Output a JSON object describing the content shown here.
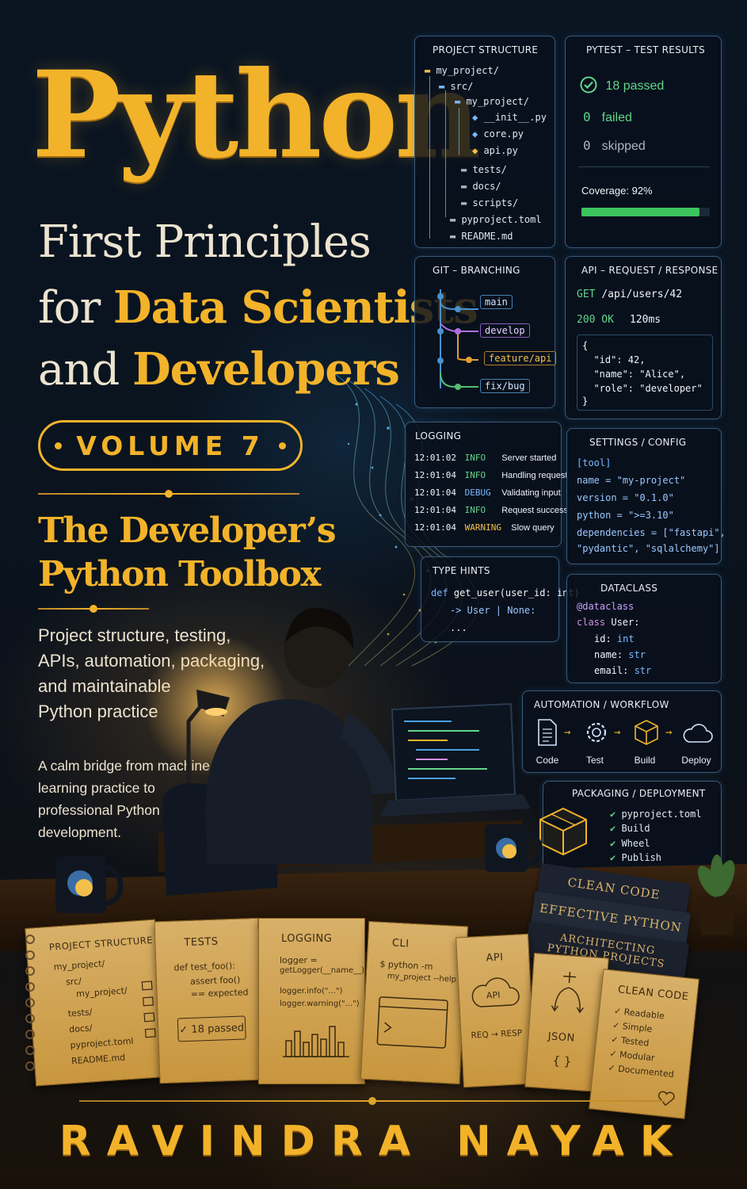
{
  "title": {
    "main": "Python",
    "line1": "First Principles",
    "line2_prefix": "for ",
    "line2_accent": "Data Scientists",
    "line3_prefix": "and ",
    "line3_accent": "Developers"
  },
  "volume": {
    "label": "VOLUME 7"
  },
  "subtitle": {
    "line1": "The Developer’s",
    "line2": "Python Toolbox"
  },
  "description": {
    "lines": [
      "Project structure, testing,",
      "APIs, automation, packaging,",
      "and maintainable",
      "Python practice"
    ],
    "tagline": [
      "A calm bridge from machine",
      "learning practice to",
      "professional Python",
      "development."
    ]
  },
  "author": "RAVINDRA NAYAK",
  "panels": {
    "project_structure": {
      "heading": "PROJECT STRUCTURE",
      "items": [
        "my_project/",
        "src/",
        "my_project/",
        "__init__.py",
        "core.py",
        "api.py",
        "tests/",
        "docs/",
        "scripts/",
        "pyproject.toml",
        "README.md"
      ]
    },
    "pytest": {
      "heading": "PYTEST – TEST RESULTS",
      "passed": "18 passed",
      "failed_num": "0",
      "failed": "failed",
      "skipped_num": "0",
      "skipped": "skipped",
      "coverage_label": "Coverage: 92%",
      "coverage_value": 0.92
    },
    "git": {
      "heading": "GIT – BRANCHING",
      "branches": [
        "main",
        "develop",
        "feature/api",
        "fix/bug"
      ]
    },
    "api": {
      "heading": "API – REQUEST / RESPONSE",
      "method": "GET",
      "path": "/api/users/42",
      "status": "200 OK",
      "time": "120ms",
      "json": [
        "{",
        "  \"id\": 42,",
        "  \"name\": \"Alice\",",
        "  \"role\": \"developer\"",
        "}"
      ]
    },
    "logging": {
      "heading": "LOGGING",
      "rows": [
        {
          "time": "12:01:02",
          "level": "INFO",
          "msg": "Server started"
        },
        {
          "time": "12:01:04",
          "level": "INFO",
          "msg": "Handling request"
        },
        {
          "time": "12:01:04",
          "level": "DEBUG",
          "msg": "Validating input"
        },
        {
          "time": "12:01:04",
          "level": "INFO",
          "msg": "Request success"
        },
        {
          "time": "12:01:04",
          "level": "WARNING",
          "msg": "Slow query"
        }
      ]
    },
    "settings": {
      "heading": "SETTINGS / CONFIG",
      "lines": [
        "[tool]",
        "name = \"my-project\"",
        "version = \"0.1.0\"",
        "python = \">=3.10\"",
        "dependencies = [\"fastapi\",",
        "\"pydantic\", \"sqlalchemy\"]"
      ]
    },
    "type_hints": {
      "heading": "TYPE HINTS",
      "line1_kw": "def",
      "line1_rest": " get_user(user_id: int)",
      "line2": "-> User | None:",
      "line3": "..."
    },
    "dataclass": {
      "heading": "DATACLASS",
      "decorator": "@dataclass",
      "class_kw": "class",
      "class_name": " User:",
      "fields": [
        {
          "name": "id: ",
          "type": "int"
        },
        {
          "name": "name: ",
          "type": "str"
        },
        {
          "name": "email: ",
          "type": "str"
        }
      ]
    },
    "automation": {
      "heading": "AUTOMATION / WORKFLOW",
      "steps": [
        {
          "label": "Code",
          "icon": "document-icon"
        },
        {
          "label": "Test",
          "icon": "gear-icon"
        },
        {
          "label": "Build",
          "icon": "cube-icon"
        },
        {
          "label": "Deploy",
          "icon": "cloud-icon"
        }
      ]
    },
    "packaging": {
      "heading": "PACKAGING / DEPLOYMENT",
      "items": [
        "pyproject.toml",
        "Build",
        "Wheel",
        "Publish"
      ]
    }
  },
  "books": [
    "CLEAN CODE",
    "EFFECTIVE PYTHON",
    "ARCHITECTING",
    "PYTHON PROJECTS"
  ],
  "notebook": {
    "project": {
      "title": "PROJECT STRUCTURE",
      "lines": [
        "my_project/",
        "src/",
        "my_project/",
        "tests/",
        "docs/",
        "pyproject.toml",
        "README.md"
      ]
    },
    "tests": {
      "title": "TESTS",
      "lines": [
        "def test_foo():",
        "assert foo()",
        "== expected"
      ],
      "badge": "✓ 18 passed"
    },
    "logging": {
      "title": "LOGGING",
      "lines": [
        "logger =",
        "getLogger(__name__)",
        "logger.info(\"...\")",
        "logger.warning(\"...\")"
      ]
    },
    "cli": {
      "title": "CLI",
      "lines": [
        "$ python -m",
        "my_project --help"
      ]
    },
    "api": {
      "title": "API",
      "badge": "API",
      "line": "REQ → RESP"
    },
    "json": {
      "title": "JSON",
      "braces": "{ }"
    },
    "clean": {
      "title": "CLEAN CODE",
      "items": [
        "Readable",
        "Simple",
        "Tested",
        "Modular",
        "Documented"
      ]
    }
  },
  "colors": {
    "gold": "#f2b32a",
    "cream": "#ece3cf",
    "panel_border": "#3a5a7a",
    "success": "#62d68a"
  }
}
